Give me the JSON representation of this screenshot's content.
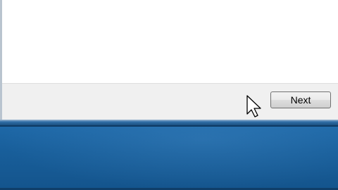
{
  "dialog": {
    "next_label": "Next"
  },
  "cursor": {
    "icon": "arrow-pointer-icon"
  },
  "colors": {
    "desktop": "#1b5d96",
    "dialog_background": "#ffffff",
    "footer_background": "#f0f0f0"
  }
}
